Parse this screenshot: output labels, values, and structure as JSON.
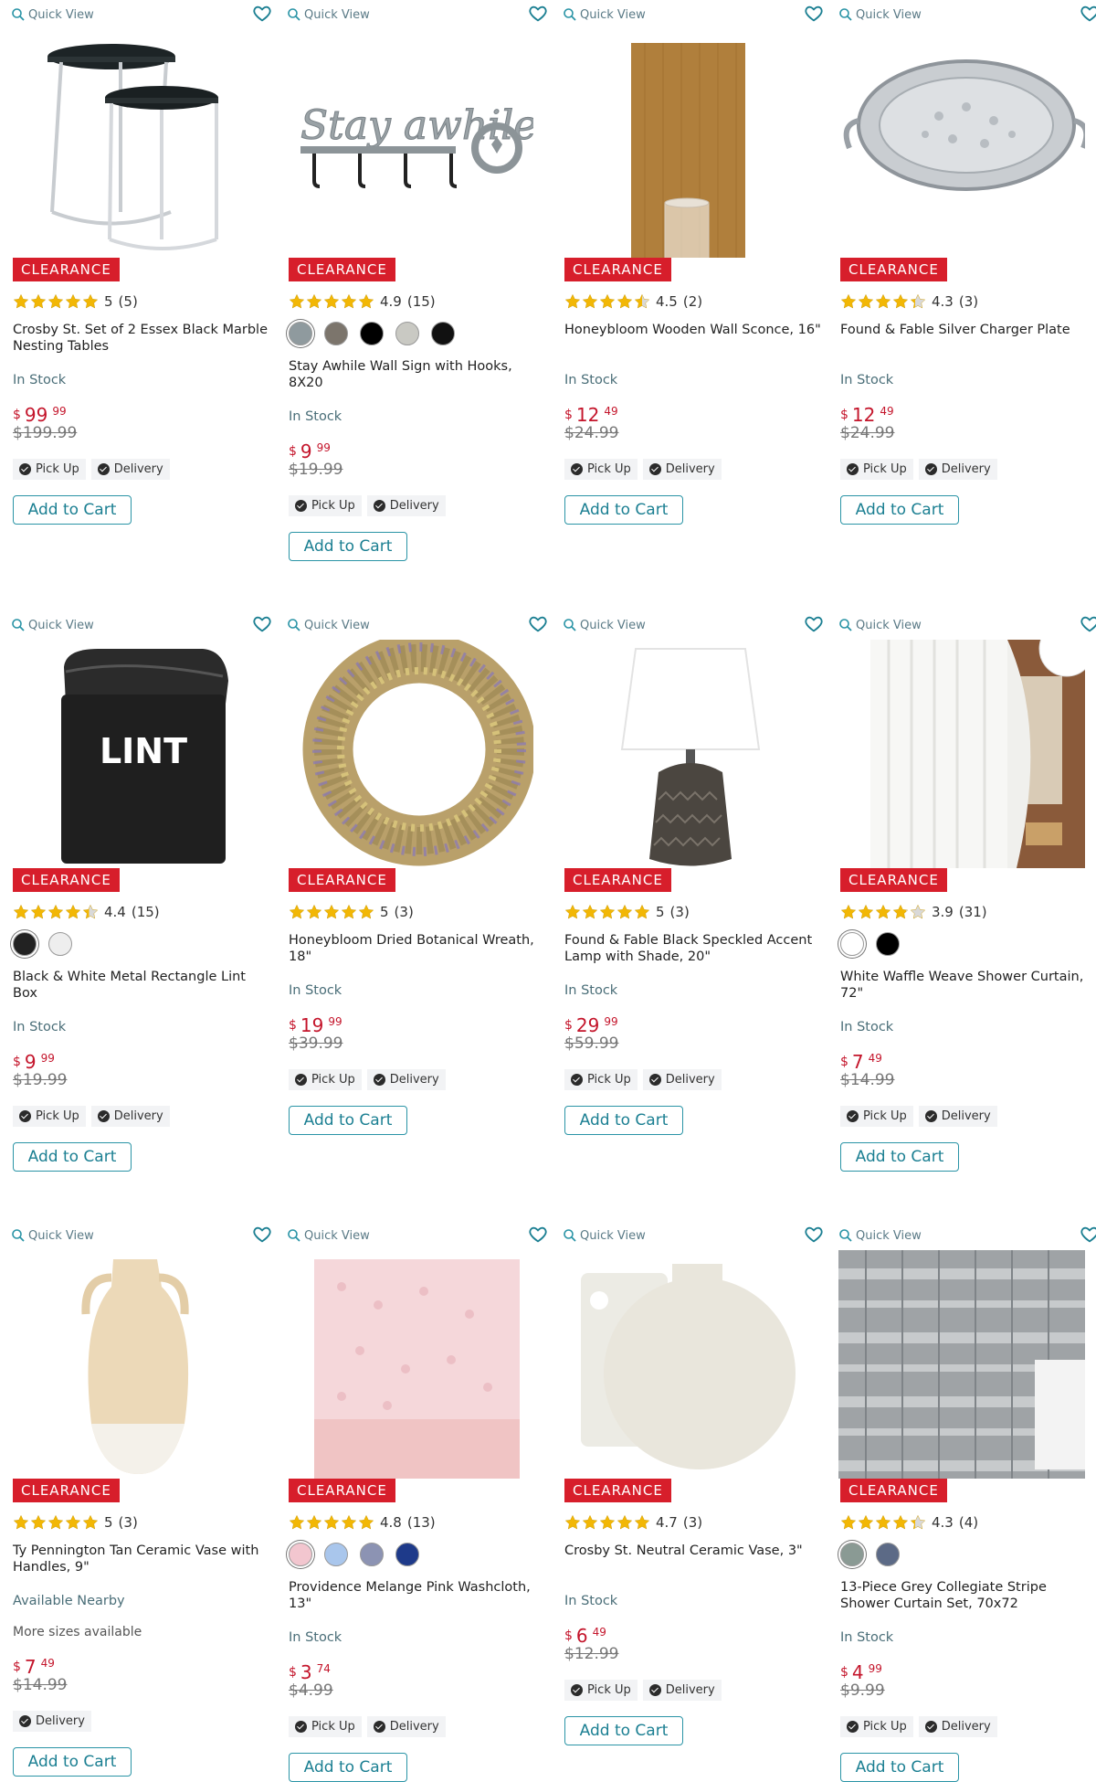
{
  "common": {
    "quick_view": "Quick View",
    "clearance": "CLEARANCE",
    "pick_up": "Pick Up",
    "delivery": "Delivery",
    "add_to_cart": "Add to Cart",
    "currency": "$"
  },
  "colors": {
    "accent": "#2a94a6",
    "sale": "#d71e2b",
    "star": "#f2b705"
  },
  "products": [
    {
      "image": "marble-nesting-tables-image",
      "rating": "5",
      "reviews": "(5)",
      "stars": 5,
      "name": "Crosby St. Set of 2 Essex Black Marble Nesting Tables",
      "swatches": [],
      "stock": "In Stock",
      "price_dollars": "99",
      "price_cents": "99",
      "was": "$199.99",
      "pickup": true,
      "delivery": true
    },
    {
      "image": "stay-awhile-sign-image",
      "rating": "4.9",
      "reviews": "(15)",
      "stars": 5,
      "name": "Stay Awhile Wall Sign with Hooks, 8X20",
      "swatches": [
        "#8f9a9e",
        "#7c756c",
        "#000000",
        "#c9c9c3",
        "#111111"
      ],
      "stock": "In Stock",
      "price_dollars": "9",
      "price_cents": "99",
      "was": "$19.99",
      "pickup": true,
      "delivery": true
    },
    {
      "image": "wooden-wall-sconce-image",
      "rating": "4.5",
      "reviews": "(2)",
      "stars": 4.5,
      "name": "Honeybloom Wooden Wall Sconce, 16\"",
      "swatches": [],
      "stock": "In Stock",
      "price_dollars": "12",
      "price_cents": "49",
      "was": "$24.99",
      "pickup": true,
      "delivery": true
    },
    {
      "image": "silver-charger-plate-image",
      "rating": "4.3",
      "reviews": "(3)",
      "stars": 4.3,
      "name": "Found & Fable Silver Charger Plate",
      "swatches": [],
      "stock": "In Stock",
      "price_dollars": "12",
      "price_cents": "49",
      "was": "$24.99",
      "pickup": true,
      "delivery": true
    },
    {
      "image": "lint-box-image",
      "image_label": "LINT",
      "rating": "4.4",
      "reviews": "(15)",
      "stars": 4.4,
      "name": "Black & White Metal Rectangle Lint Box",
      "swatches": [
        "#222222",
        "#eeeeee"
      ],
      "stock": "In Stock",
      "price_dollars": "9",
      "price_cents": "99",
      "was": "$19.99",
      "pickup": true,
      "delivery": true
    },
    {
      "image": "botanical-wreath-image",
      "rating": "5",
      "reviews": "(3)",
      "stars": 5,
      "name": "Honeybloom Dried Botanical Wreath, 18\"",
      "swatches": [],
      "stock": "In Stock",
      "price_dollars": "19",
      "price_cents": "99",
      "was": "$39.99",
      "pickup": true,
      "delivery": true
    },
    {
      "image": "accent-lamp-image",
      "rating": "5",
      "reviews": "(3)",
      "stars": 5,
      "name": "Found & Fable Black Speckled Accent Lamp with Shade, 20\"",
      "swatches": [],
      "stock": "In Stock",
      "price_dollars": "29",
      "price_cents": "99",
      "was": "$59.99",
      "pickup": true,
      "delivery": true
    },
    {
      "image": "waffle-shower-curtain-image",
      "rating": "3.9",
      "reviews": "(31)",
      "stars": 3.9,
      "name": "White Waffle Weave Shower Curtain, 72\"",
      "swatches": [
        "#ffffff",
        "#000000"
      ],
      "stock": "In Stock",
      "price_dollars": "7",
      "price_cents": "49",
      "was": "$14.99",
      "pickup": true,
      "delivery": true
    },
    {
      "image": "tan-ceramic-vase-image",
      "rating": "5",
      "reviews": "(3)",
      "stars": 5,
      "name": "Ty Pennington Tan Ceramic Vase with Handles, 9\"",
      "swatches": [],
      "stock": "Available Nearby",
      "sizes": "More sizes available",
      "price_dollars": "7",
      "price_cents": "49",
      "was": "$14.99",
      "pickup": false,
      "delivery": true
    },
    {
      "image": "pink-washcloth-image",
      "rating": "4.8",
      "reviews": "(13)",
      "stars": 5,
      "name": "Providence Melange Pink Washcloth, 13\"",
      "swatches": [
        "#f2c6cf",
        "#a9c6ec",
        "#8c93b3",
        "#1e3a8a"
      ],
      "stock": "In Stock",
      "price_dollars": "3",
      "price_cents": "74",
      "was": "$4.99",
      "pickup": true,
      "delivery": true
    },
    {
      "image": "neutral-ceramic-vase-image",
      "rating": "4.7",
      "reviews": "(3)",
      "stars": 5,
      "name": "Crosby St. Neutral Ceramic Vase, 3\"",
      "swatches": [],
      "stock": "In Stock",
      "price_dollars": "6",
      "price_cents": "49",
      "was": "$12.99",
      "pickup": true,
      "delivery": true
    },
    {
      "image": "grey-stripe-curtain-image",
      "rating": "4.3",
      "reviews": "(4)",
      "stars": 4.3,
      "name": "13-Piece Grey Collegiate Stripe Shower Curtain Set, 70x72",
      "swatches": [
        "#8a9a94",
        "#5c6a86"
      ],
      "stock": "In Stock",
      "price_dollars": "4",
      "price_cents": "99",
      "was": "$9.99",
      "pickup": true,
      "delivery": true
    }
  ]
}
